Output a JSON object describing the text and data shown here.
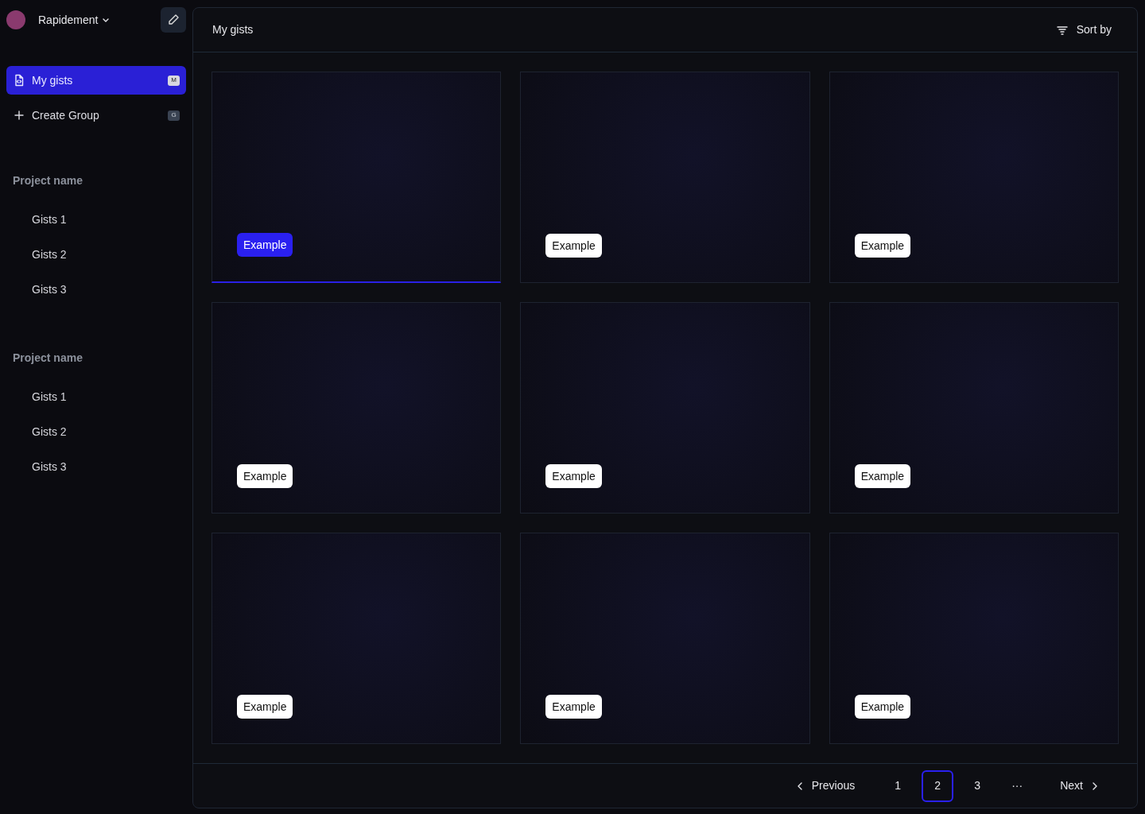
{
  "workspace": {
    "name": "Rapidement"
  },
  "nav": [
    {
      "label": "My gists",
      "shortcut": "M",
      "kind": "file",
      "selected": true
    },
    {
      "label": "Create Group",
      "shortcut": "G",
      "kind": "plus",
      "selected": false
    }
  ],
  "projects": [
    {
      "title": "Project name",
      "items": [
        {
          "label": "Gists 1"
        },
        {
          "label": "Gists 2"
        },
        {
          "label": "Gists 3"
        }
      ]
    },
    {
      "title": "Project name",
      "items": [
        {
          "label": "Gists 1"
        },
        {
          "label": "Gists 2"
        },
        {
          "label": "Gists 3"
        }
      ]
    }
  ],
  "header": {
    "title": "My gists",
    "sort": "Sort by"
  },
  "cards": [
    {
      "tag": "Example",
      "selected": true
    },
    {
      "tag": "Example",
      "selected": false
    },
    {
      "tag": "Example",
      "selected": false
    },
    {
      "tag": "Example",
      "selected": false
    },
    {
      "tag": "Example",
      "selected": false
    },
    {
      "tag": "Example",
      "selected": false
    },
    {
      "tag": "Example",
      "selected": false
    },
    {
      "tag": "Example",
      "selected": false
    },
    {
      "tag": "Example",
      "selected": false
    }
  ],
  "pagination": {
    "previous": "Previous",
    "next": "Next",
    "pages": [
      {
        "label": "1",
        "selected": false
      },
      {
        "label": "2",
        "selected": true
      },
      {
        "label": "3",
        "selected": false
      },
      {
        "label": "···",
        "selected": false
      }
    ]
  }
}
